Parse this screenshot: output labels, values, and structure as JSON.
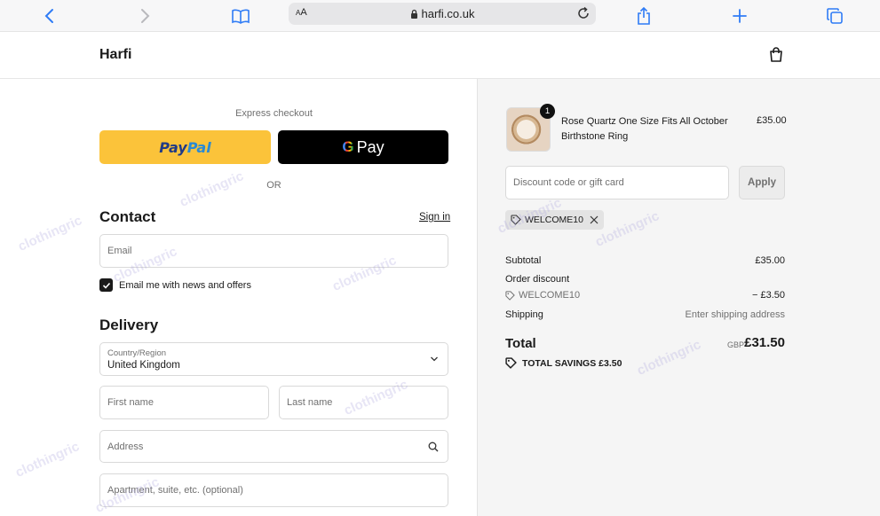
{
  "browser": {
    "url_text_size": "AA",
    "url": "harfi.co.uk"
  },
  "store": {
    "name": "Harfi"
  },
  "checkout": {
    "express_label": "Express checkout",
    "paypal_pay": "Pay",
    "paypal_pal": "Pal",
    "gpay_g": "G",
    "gpay_label": "Pay",
    "or_label": "OR",
    "contact_title": "Contact",
    "signin_label": "Sign in",
    "email_placeholder": "Email",
    "newsletter_label": "Email me with news and offers",
    "newsletter_checked": true,
    "delivery_title": "Delivery",
    "country_label": "Country/Region",
    "country_value": "United Kingdom",
    "first_name_placeholder": "First name",
    "last_name_placeholder": "Last name",
    "address_placeholder": "Address",
    "apartment_placeholder": "Apartment, suite, etc. (optional)"
  },
  "summary": {
    "product": {
      "quantity": "1",
      "name": "Rose Quartz One Size Fits All October Birthstone Ring",
      "price": "£35.00"
    },
    "discount_placeholder": "Discount code or gift card",
    "apply_label": "Apply",
    "applied_code": "WELCOME10",
    "subtotal_label": "Subtotal",
    "subtotal_value": "£35.00",
    "order_discount_label": "Order discount",
    "discount_code": "WELCOME10",
    "discount_value": "− £3.50",
    "shipping_label": "Shipping",
    "shipping_value": "Enter shipping address",
    "total_label": "Total",
    "total_currency": "GBP",
    "total_value": "£31.50",
    "savings_label": "TOTAL SAVINGS",
    "savings_value": "£3.50"
  },
  "watermark": "clothingric",
  "colors": {
    "paypal_bg": "#fbc33a",
    "gpay_bg": "#000000",
    "summary_bg": "#f5f5f5"
  }
}
